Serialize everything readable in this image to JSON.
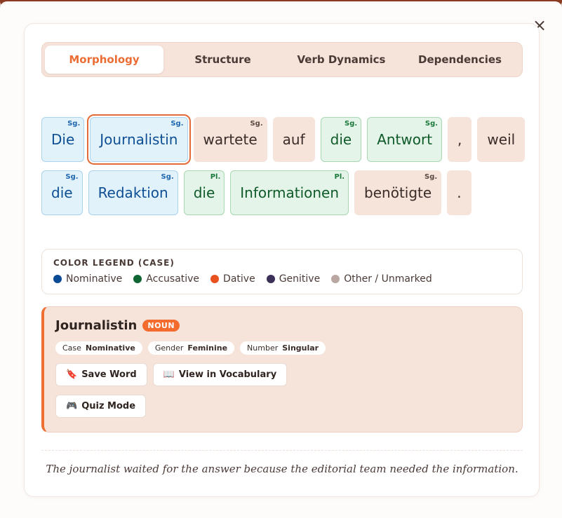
{
  "close_symbol": "×",
  "tabs": [
    {
      "label": "Morphology",
      "active": true
    },
    {
      "label": "Structure",
      "active": false
    },
    {
      "label": "Verb Dynamics",
      "active": false
    },
    {
      "label": "Dependencies",
      "active": false
    }
  ],
  "sentence": {
    "rows": [
      [
        {
          "text": "Die",
          "case": "nom",
          "number": "Sg."
        },
        {
          "text": "Journalistin",
          "case": "nom",
          "number": "Sg.",
          "selected": true
        },
        {
          "text": "wartete",
          "case": "oth",
          "number": "Sg."
        },
        {
          "text": "auf",
          "case": "oth",
          "number": ""
        },
        {
          "text": "die",
          "case": "acc",
          "number": "Sg."
        },
        {
          "text": "Antwort",
          "case": "acc",
          "number": "Sg."
        },
        {
          "text": ",",
          "case": "oth",
          "number": ""
        },
        {
          "text": "weil",
          "case": "oth",
          "number": ""
        }
      ],
      [
        {
          "text": "die",
          "case": "nom",
          "number": "Sg."
        },
        {
          "text": "Redaktion",
          "case": "nom",
          "number": "Sg."
        },
        {
          "text": "die",
          "case": "acc",
          "number": "Pl."
        },
        {
          "text": "Informationen",
          "case": "acc",
          "number": "Pl."
        },
        {
          "text": "benötigte",
          "case": "oth",
          "number": "Sg."
        },
        {
          "text": ".",
          "case": "oth",
          "number": ""
        }
      ]
    ]
  },
  "legend": {
    "title": "COLOR LEGEND (CASE)",
    "items": [
      {
        "label": "Nominative",
        "color": "#0b4a94"
      },
      {
        "label": "Accusative",
        "color": "#106633"
      },
      {
        "label": "Dative",
        "color": "#e9521f"
      },
      {
        "label": "Genitive",
        "color": "#3b3057"
      },
      {
        "label": "Other / Unmarked",
        "color": "#baa7a2"
      }
    ]
  },
  "detail": {
    "word": "Journalistin",
    "pos": "NOUN",
    "features": [
      {
        "key": "Case",
        "value": "Nominative"
      },
      {
        "key": "Gender",
        "value": "Feminine"
      },
      {
        "key": "Number",
        "value": "Singular"
      }
    ],
    "actions": [
      {
        "icon": "🔖",
        "label": "Save Word",
        "name": "save-word-button"
      },
      {
        "icon": "📖",
        "label": "View in Vocabulary",
        "name": "view-vocabulary-button"
      },
      {
        "icon": "🎮",
        "label": "Quiz Mode",
        "name": "quiz-mode-button"
      }
    ]
  },
  "translation": "The journalist waited for the answer because the editorial team needed the information."
}
